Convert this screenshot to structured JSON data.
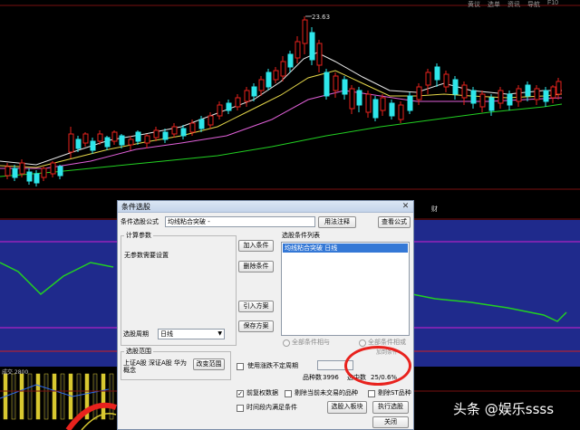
{
  "chart": {
    "top_menu": [
      "黄议",
      "选单",
      "资讯",
      "导航",
      "F10"
    ],
    "peak_label": "23.63",
    "mid_tag": "财",
    "bottom_panel_label": "成交 2800"
  },
  "dialog": {
    "title": "条件选股",
    "formula_label": "条件选股公式",
    "formula_value": "均线粘合突破 -",
    "usage_button": "用法注释",
    "view_formula_button": "查看公式",
    "params_group": "计算参数",
    "no_params": "无参数需要设置",
    "add_condition": "加入条件",
    "delete_condition": "删除条件",
    "import_plan": "引入方案",
    "save_plan": "保存方案",
    "list_title": "选股条件列表",
    "list_items": [
      "均线粘合突破    日线"
    ],
    "period_label": "选股周期",
    "period_value": "日线",
    "radio_and": "全部条件相与",
    "radio_or": "全部条件相或",
    "range_group": "选股范围",
    "range_text": "上证A股 深证A股 华为概念",
    "change_range": "改变范围",
    "uncertain_period": "使用涨跌不定周期",
    "count_label": "品种数",
    "count_value": "3996",
    "selected_label": "选中数",
    "selected_value": "25/0.6%",
    "adjust_label": "前复权数据",
    "exclude_untraded": "剔除当前未交易的品种",
    "exclude_st": "剔除ST品种",
    "time_period": "时间段内满足条件",
    "to_board": "选股入板块",
    "run": "执行选股",
    "close": "关闭",
    "stray_text": "加到条件"
  },
  "watermark": "头条 @娱乐ssss",
  "colors": {
    "up": "#e8221d",
    "down": "#2ee6ea",
    "ma_white": "#e8e8e8",
    "ma_yellow": "#e6d84a",
    "ma_pink": "#e060d8",
    "ma_green": "#22d022",
    "indicator_bg": "#1f2a8c",
    "dialog_bg": "#f0f0f0",
    "selection": "#3478d6",
    "highlight_circle": "#e8221d"
  }
}
